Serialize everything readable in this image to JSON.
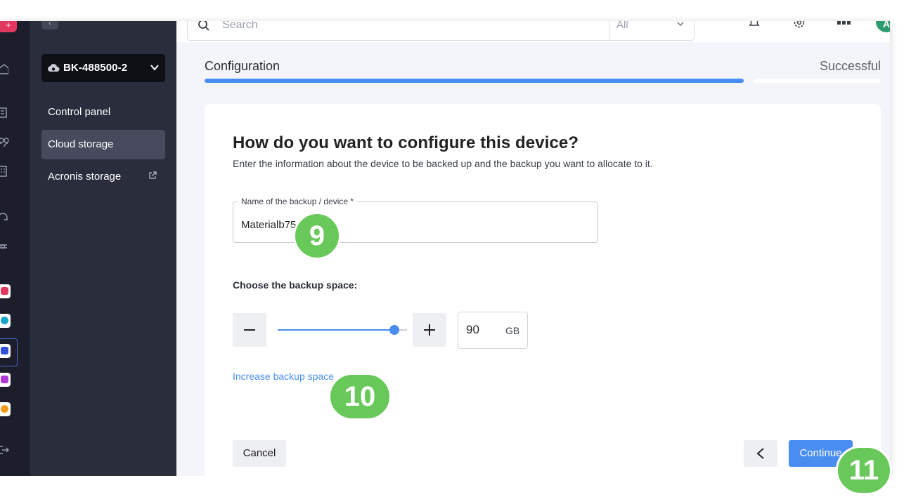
{
  "rail": {
    "logo": "+",
    "icons": [
      "home-icon",
      "building-icon",
      "users-icon",
      "office-icon",
      "support-icon",
      "settings-gear-icon",
      "logout-icon"
    ],
    "app_tiles": [
      {
        "name": "app-tile-x",
        "color": "#e2385f"
      },
      {
        "name": "app-tile-drive",
        "color": "#1aa5c9"
      },
      {
        "name": "app-tile-backup",
        "color": "#3050d8"
      },
      {
        "name": "app-tile-mail",
        "color": "#b039d6"
      },
      {
        "name": "app-tile-sync",
        "color": "#f29a1c"
      }
    ]
  },
  "sidebar": {
    "collapse_glyph": "‹",
    "device_selector": {
      "label": "BK-488500-2"
    },
    "items": [
      {
        "label": "Control panel"
      },
      {
        "label": "Cloud storage"
      },
      {
        "label": "Acronis storage"
      }
    ]
  },
  "topbar": {
    "search_placeholder": "Search",
    "search_scope": "All",
    "avatar_initial": "A"
  },
  "steps": {
    "current": "Configuration",
    "last": "Successful"
  },
  "form": {
    "title": "How do you want to configure this device?",
    "subtitle": "Enter the information about the device to be backed up and the backup you want to allocate to it.",
    "name_field": {
      "label": "Name of the backup / device *",
      "value": "Materialb75"
    },
    "space_label": "Choose the backup space:",
    "space": {
      "value": "90",
      "unit": "GB",
      "slider_fraction": 0.9
    },
    "increase_link": "Increase backup space",
    "cancel_label": "Cancel",
    "continue_label": "Continue"
  },
  "annotations": {
    "badge_9": "9",
    "badge_10": "10",
    "badge_11": "11",
    "color": "#68c95a"
  },
  "colors": {
    "accent": "#4a8df0",
    "sidebar_bg": "#2a2d3b",
    "rail_bg": "#1c1f2b"
  }
}
